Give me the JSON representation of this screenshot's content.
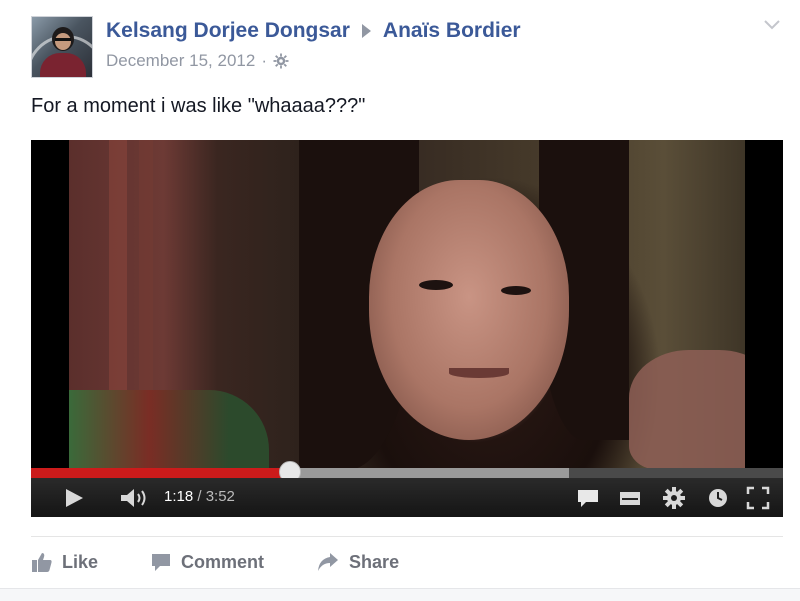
{
  "post": {
    "author": "Kelsang Dorjee Dongsar",
    "recipient": "Anaïs Bordier",
    "date": "December 15, 2012",
    "separator": "·",
    "text": "For a moment i was like \"whaaaa???\""
  },
  "video": {
    "current_time": "1:18",
    "duration": "/ 3:52",
    "played_fraction": 0.345,
    "buffered_fraction": 0.715
  },
  "actions": {
    "like_label": "Like",
    "comment_label": "Comment",
    "share_label": "Share"
  },
  "colors": {
    "name_link": "#3b5998",
    "meta_text": "#9197a3",
    "action_text": "#6d7079",
    "progress_played": "#cc1b1b"
  },
  "icons": {
    "arrow": "triangle-right-icon",
    "privacy": "globe-icon",
    "menu": "chevron-down-icon",
    "player": [
      "play-icon",
      "volume-icon",
      "captions-icon",
      "subtitles-icon",
      "settings-icon",
      "watch-later-icon",
      "fullscreen-icon"
    ],
    "actions": [
      "thumbs-up-icon",
      "comment-icon",
      "share-icon"
    ]
  }
}
